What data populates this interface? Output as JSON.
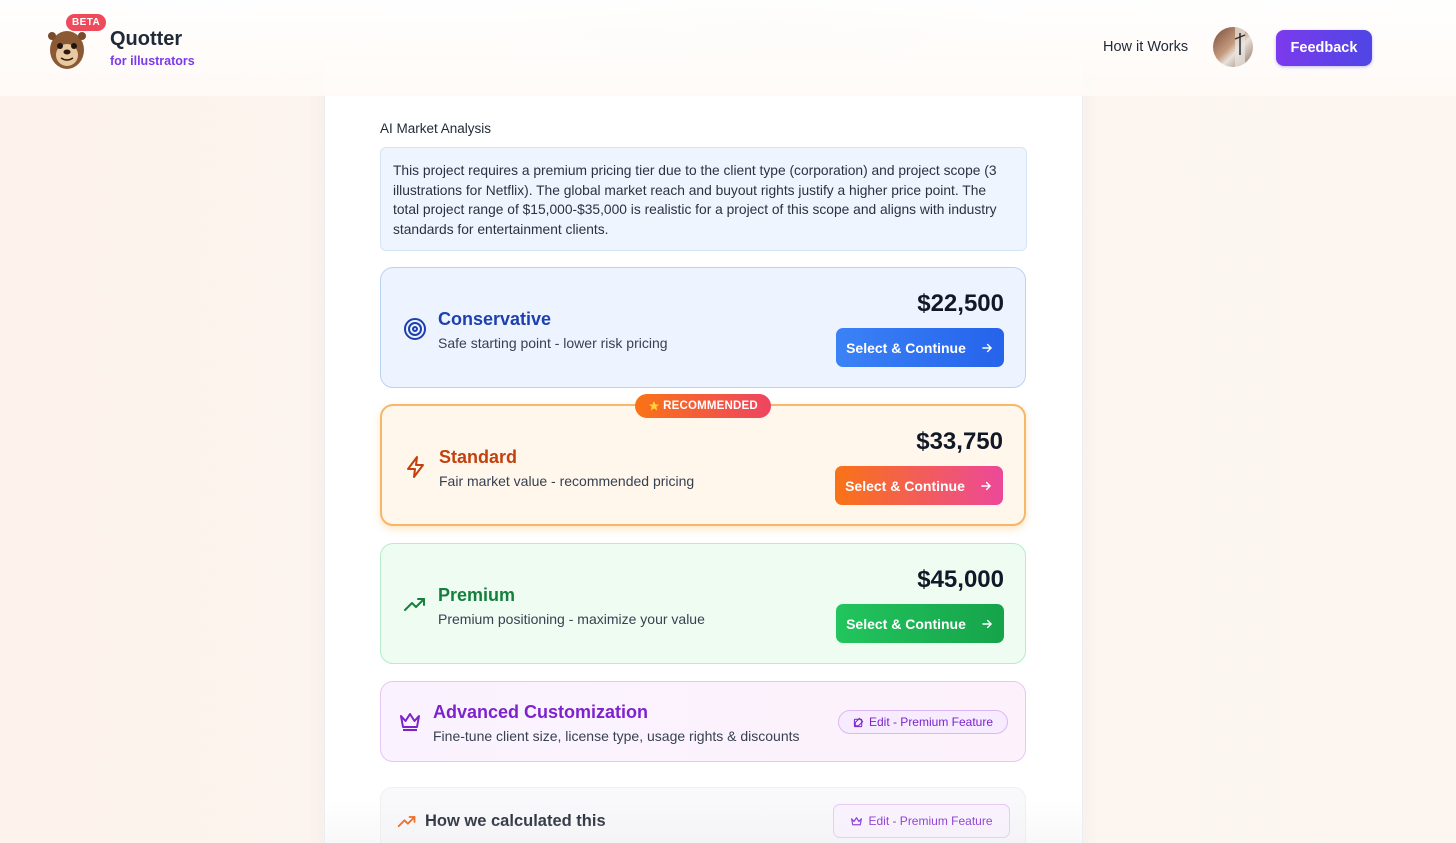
{
  "header": {
    "badge": "BETA",
    "brand": "Quotter",
    "brand_sub": "for illustrators",
    "nav_link": "How it Works",
    "feedback_label": "Feedback"
  },
  "analysis": {
    "title": "AI Market Analysis",
    "text": "This project requires a premium pricing tier due to the client type (corporation) and project scope (3 illustrations for Netflix). The global market reach and buyout rights justify a higher price point. The total project range of $15,000-$35,000 is realistic for a project of this scope and aligns with industry standards for entertainment clients."
  },
  "tiers": [
    {
      "name": "Conservative",
      "desc": "Safe starting point - lower risk pricing",
      "price": "$22,500",
      "button": "Select & Continue",
      "icon": "target-icon",
      "accent": "#1e40af"
    },
    {
      "name": "Standard",
      "desc": "Fair market value - recommended pricing",
      "price": "$33,750",
      "button": "Select & Continue",
      "icon": "lightning-icon",
      "accent": "#c2410c",
      "badge": "RECOMMENDED"
    },
    {
      "name": "Premium",
      "desc": "Premium positioning - maximize your value",
      "price": "$45,000",
      "button": "Select & Continue",
      "icon": "trending-up-icon",
      "accent": "#15803d"
    }
  ],
  "advanced": {
    "title": "Advanced Customization",
    "desc": "Fine-tune client size, license type, usage rights & discounts",
    "edit_label": "Edit - Premium Feature",
    "icon": "crown-icon"
  },
  "how": {
    "title": "How we calculated this",
    "edit_label": "Edit - Premium Feature",
    "icon": "trending-up-icon"
  }
}
